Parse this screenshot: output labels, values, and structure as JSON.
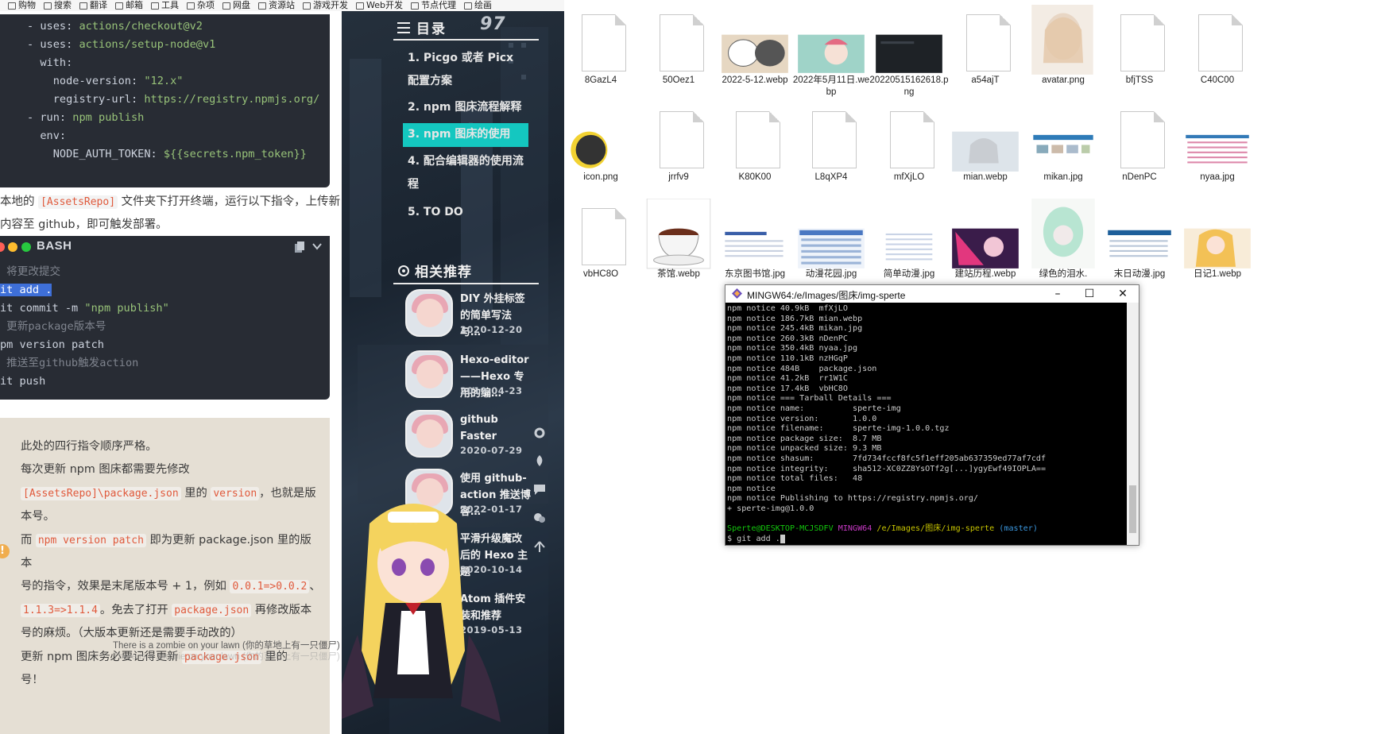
{
  "bookmarks": [
    "购物",
    "搜索",
    "翻译",
    "邮箱",
    "工具",
    "杂项",
    "网盘",
    "资源站",
    "游戏开发",
    "Web开发",
    "节点代理",
    "绘画"
  ],
  "code_block_1": {
    "lines": [
      [
        {
          "t": "- uses: ",
          "c": "k"
        },
        {
          "t": "actions/checkout@v2",
          "c": "s"
        }
      ],
      [
        {
          "t": "- uses: ",
          "c": "k"
        },
        {
          "t": "actions/setup-node@v1",
          "c": "s"
        }
      ],
      [
        {
          "t": "  with:",
          "c": "k"
        }
      ],
      [
        {
          "t": "    node-version: ",
          "c": "k"
        },
        {
          "t": "\"12.x\"",
          "c": "s"
        }
      ],
      [
        {
          "t": "    registry-url: ",
          "c": "k"
        },
        {
          "t": "https://registry.npmjs.org/",
          "c": "s"
        }
      ],
      [
        {
          "t": "- run: ",
          "c": "k"
        },
        {
          "t": "npm publish",
          "c": "s"
        }
      ],
      [
        {
          "t": "  env:",
          "c": "k"
        }
      ],
      [
        {
          "t": "    NODE_AUTH_TOKEN: ",
          "c": "k"
        },
        {
          "t": "${{secrets.npm_token}}",
          "c": "s"
        }
      ]
    ]
  },
  "para1": {
    "line1_pre": "本地的 ",
    "line1_code": "[AssetsRepo]",
    "line1_post": " 文件夹下打开终端，运行以下指令，上传新",
    "line2": "内容至 github，即可触发部署。"
  },
  "code_block_2": {
    "lang": "BASH",
    "lines": [
      [
        {
          "t": " 将更改提交",
          "c": "c"
        }
      ],
      [
        {
          "t": "it add .",
          "c": "sel"
        }
      ],
      [
        {
          "t": "it commit -m ",
          "c": "k"
        },
        {
          "t": "\"npm publish\"",
          "c": "s"
        }
      ],
      [
        {
          "t": " 更新package版本号",
          "c": "c"
        }
      ],
      [
        {
          "t": "pm version patch",
          "c": "k"
        }
      ],
      [
        {
          "t": " 推送至github触发action",
          "c": "c"
        }
      ],
      [
        {
          "t": "it push",
          "c": "k"
        }
      ]
    ]
  },
  "tip": {
    "l1": "此处的四行指令顺序严格。",
    "l2": "每次更新 npm 图床都需要先修改",
    "l3_code1": "[AssetsRepo]\\package.json",
    "l3_mid": " 里的 ",
    "l3_code2": "version",
    "l3_post": "，也就是版",
    "l4": "本号。",
    "l5_pre": "而 ",
    "l5_code": "npm version patch",
    "l5_post": " 即为更新 package.json 里的版本",
    "l6_pre": "号的指令，效果是末尾版本号 + 1，例如 ",
    "l6_code": "0.0.1=>0.0.2",
    "l6_post": "、",
    "l7_code1": "1.1.3=>1.1.4",
    "l7_mid": "。免去了打开 ",
    "l7_code2": "package.json",
    "l7_post": " 再修改版本",
    "l8": "号的麻烦。（大版本更新还是需要手动改的）",
    "l9_pre": "更新 npm 图床务必要记得更新 ",
    "l9_code": "package.json",
    "l9_post": " 里的",
    "l10": "号！",
    "warn_icon": "!"
  },
  "marquee": "There is a zombie on your lawn (你的草地上有一只僵尸)",
  "sidebar": {
    "toc_title": "目录",
    "toc_number": "97",
    "toc": [
      "1. Picgo 或者 Picx 配置方案",
      "2. npm 图床流程解释",
      "3. npm 图床的使用",
      "4. 配合编辑器的使用流程",
      "5. TO DO"
    ],
    "rec_title": "相关推荐",
    "recommendations": [
      {
        "title": "DIY 外挂标签的简单写法与…",
        "date": "2020-12-20"
      },
      {
        "title": "Hexo-editor——Hexo 专用的编…",
        "date": "2019-04-23"
      },
      {
        "title": "github Faster",
        "date": "2020-07-29"
      },
      {
        "title": "使用 github-action 推送博客…",
        "date": "2022-01-17"
      },
      {
        "title": "平滑升级魔改后的 Hexo 主题",
        "date": "2020-10-14"
      },
      {
        "title": "Atom 插件安装和推荐",
        "date": "2019-05-13"
      }
    ]
  },
  "explorer": {
    "files": [
      {
        "name": "8GazL4",
        "kind": "blank"
      },
      {
        "name": "50Oez1",
        "kind": "blank"
      },
      {
        "name": "2022-5-12.webp",
        "kind": "cat"
      },
      {
        "name": "2022年5月11日.webp",
        "kind": "girl-teal"
      },
      {
        "name": "20220515162618.png",
        "kind": "dark"
      },
      {
        "name": "a54ajT",
        "kind": "blank"
      },
      {
        "name": "avatar.png",
        "kind": "avatar"
      },
      {
        "name": "bfjTSS",
        "kind": "blank"
      },
      {
        "name": "C40C00",
        "kind": "blank"
      },
      {
        "name": "icon.png",
        "kind": "moon"
      },
      {
        "name": "jrrfv9",
        "kind": "blank"
      },
      {
        "name": "K80K00",
        "kind": "blank"
      },
      {
        "name": "L8qXP4",
        "kind": "blank"
      },
      {
        "name": "mfXjLO",
        "kind": "blank"
      },
      {
        "name": "mian.webp",
        "kind": "anime-grey"
      },
      {
        "name": "mikan.jpg",
        "kind": "web"
      },
      {
        "name": "nDenPC",
        "kind": "blank"
      },
      {
        "name": "nyaa.jpg",
        "kind": "web2"
      },
      {
        "name": "vbHC8O",
        "kind": "blank"
      },
      {
        "name": "茶馆.webp",
        "kind": "tea"
      },
      {
        "name": "东京图书馆.jpg",
        "kind": "web3"
      },
      {
        "name": "动漫花园.jpg",
        "kind": "web4"
      },
      {
        "name": "简单动漫.jpg",
        "kind": "web5"
      },
      {
        "name": "建站历程.webp",
        "kind": "pink"
      },
      {
        "name": "绿色的泪水.",
        "kind": "green"
      },
      {
        "name": "末日动漫.jpg",
        "kind": "web6"
      },
      {
        "name": "日记1.webp",
        "kind": "anime-yellow"
      }
    ]
  },
  "terminal": {
    "title": "MINGW64:/e/Images/图床/img-sperte",
    "lines": [
      "npm notice 40.9kB  mfXjLO",
      "npm notice 186.7kB mian.webp",
      "npm notice 245.4kB mikan.jpg",
      "npm notice 260.3kB nDenPC",
      "npm notice 350.4kB nyaa.jpg",
      "npm notice 110.1kB nzHGqP",
      "npm notice 484B    package.json",
      "npm notice 41.2kB  rr1W1C",
      "npm notice 17.4kB  vbHC8O",
      "npm notice === Tarball Details ===",
      "npm notice name:          sperte-img",
      "npm notice version:       1.0.0",
      "npm notice filename:      sperte-img-1.0.0.tgz",
      "npm notice package size:  8.7 MB",
      "npm notice unpacked size: 9.3 MB",
      "npm notice shasum:        7fd734fccf8fc5f1eff205ab637359ed77af7cdf",
      "npm notice integrity:     sha512-XC0ZZ8YsOTf2g[...]ygyEwf49IOPLA==",
      "npm notice total files:   48",
      "npm notice",
      "npm notice Publishing to https://registry.npmjs.org/",
      "+ sperte-img@1.0.0",
      ""
    ],
    "prompt_user": "Sperte@DESKTOP-MCJSDFV",
    "prompt_env": "MINGW64",
    "prompt_path": "/e/Images/图床/img-sperte",
    "prompt_branch": "(master)",
    "command": "$ git add ."
  }
}
